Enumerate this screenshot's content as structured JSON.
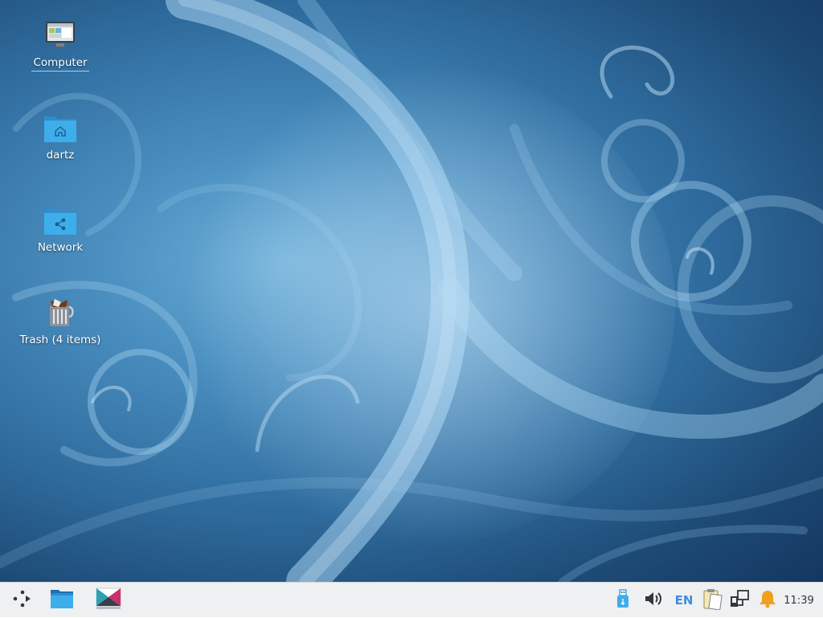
{
  "desktop": {
    "icons": [
      {
        "label": "Computer",
        "icon": "computer-icon"
      },
      {
        "label": "dartz",
        "icon": "home-folder-icon"
      },
      {
        "label": "Network",
        "icon": "network-folder-icon"
      },
      {
        "label": "Trash (4 items)",
        "icon": "trash-full-icon"
      }
    ]
  },
  "taskbar": {
    "launchers": [
      {
        "icon": "application-menu-icon"
      },
      {
        "icon": "file-manager-icon"
      },
      {
        "icon": "krita-app-icon"
      }
    ],
    "tray": {
      "items": [
        {
          "icon": "usb-removable-device-icon"
        },
        {
          "icon": "volume-icon"
        },
        {
          "icon": "clipboard-icon"
        },
        {
          "icon": "network-wired-icon"
        },
        {
          "icon": "notification-bell-icon"
        }
      ],
      "language": "EN",
      "clock": "11:39"
    }
  },
  "colors": {
    "taskbar_bg": "#eff0f1",
    "folder_blue": "#3daee9",
    "accent": "#3d8ee0",
    "bell": "#f0a020"
  }
}
